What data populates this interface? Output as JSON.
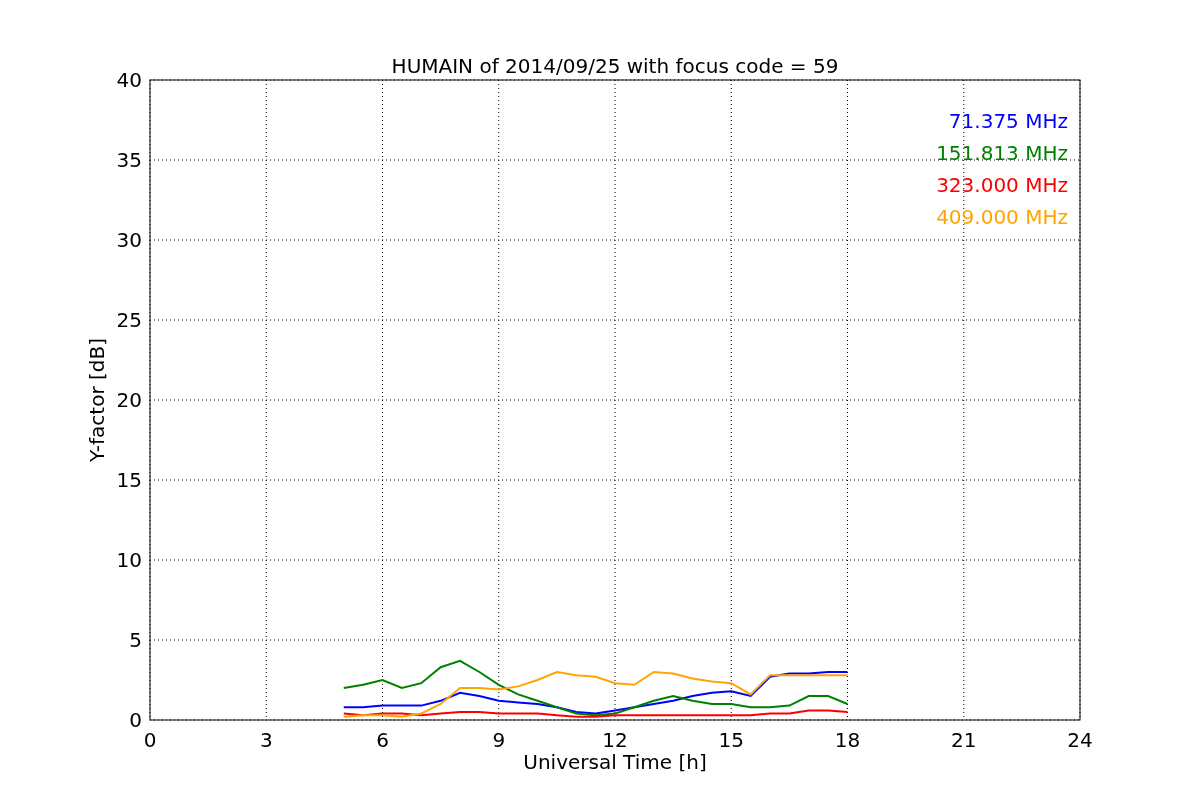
{
  "chart_data": {
    "type": "line",
    "title": "HUMAIN of 2014/09/25 with focus code = 59",
    "xlabel": "Universal Time [h]",
    "ylabel": "Y-factor [dB]",
    "x": [
      5,
      5.5,
      6,
      6.5,
      7,
      7.5,
      8,
      8.5,
      9,
      9.5,
      10,
      10.5,
      11,
      11.5,
      12,
      12.5,
      13,
      13.5,
      14,
      14.5,
      15,
      15.5,
      16,
      16.5,
      17,
      17.5,
      18
    ],
    "series": [
      {
        "name": "71.375 MHz",
        "color": "#0000ff",
        "values": [
          0.8,
          0.8,
          0.9,
          0.9,
          0.9,
          1.2,
          1.7,
          1.5,
          1.2,
          1.1,
          1.0,
          0.8,
          0.5,
          0.4,
          0.6,
          0.8,
          1.0,
          1.2,
          1.5,
          1.7,
          1.8,
          1.5,
          2.7,
          2.9,
          2.9,
          3.0,
          3.0
        ]
      },
      {
        "name": "151.813 MHz",
        "color": "#008000",
        "values": [
          2.0,
          2.2,
          2.5,
          2.0,
          2.3,
          3.3,
          3.7,
          3.0,
          2.2,
          1.6,
          1.2,
          0.8,
          0.4,
          0.3,
          0.4,
          0.8,
          1.2,
          1.5,
          1.2,
          1.0,
          1.0,
          0.8,
          0.8,
          0.9,
          1.5,
          1.5,
          1.0
        ]
      },
      {
        "name": "323.000 MHz",
        "color": "#ff0000",
        "values": [
          0.4,
          0.3,
          0.4,
          0.4,
          0.3,
          0.4,
          0.5,
          0.5,
          0.4,
          0.4,
          0.4,
          0.3,
          0.2,
          0.2,
          0.3,
          0.3,
          0.3,
          0.3,
          0.3,
          0.3,
          0.3,
          0.3,
          0.4,
          0.4,
          0.6,
          0.6,
          0.5
        ]
      },
      {
        "name": "409.000 MHz",
        "color": "#ffa500",
        "values": [
          0.2,
          0.3,
          0.3,
          0.2,
          0.4,
          1.0,
          2.0,
          2.0,
          1.9,
          2.1,
          2.5,
          3.0,
          2.8,
          2.7,
          2.3,
          2.2,
          3.0,
          2.9,
          2.6,
          2.4,
          2.3,
          1.6,
          2.8,
          2.8,
          2.8,
          2.8,
          2.8
        ]
      }
    ],
    "grid": true,
    "xlim": [
      0,
      24
    ],
    "ylim": [
      0,
      40
    ],
    "xticks": [
      0,
      3,
      6,
      9,
      12,
      15,
      18,
      21,
      24
    ],
    "yticks": [
      0,
      5,
      10,
      15,
      20,
      25,
      30,
      35,
      40
    ]
  }
}
